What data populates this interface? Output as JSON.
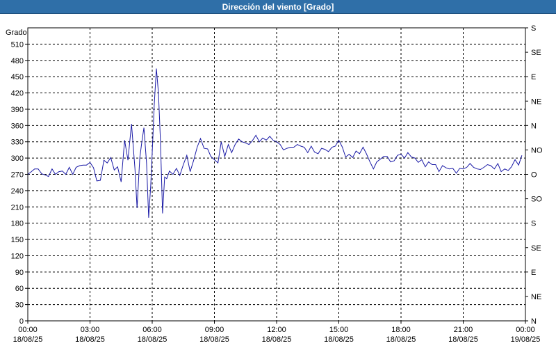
{
  "window": {
    "title": "Dirección del viento [Grado]"
  },
  "chart_data": {
    "type": "line",
    "title": "Dirección del viento [Grado]",
    "ylabel": "Grado",
    "ylim": [
      0,
      540
    ],
    "xlim": [
      0,
      24
    ],
    "y_ticks": [
      0,
      30,
      60,
      90,
      120,
      150,
      180,
      210,
      240,
      270,
      300,
      330,
      360,
      390,
      420,
      450,
      480,
      510
    ],
    "y_tick_labels": [
      "0",
      "30",
      "60",
      "90",
      "120",
      "150",
      "180",
      "210",
      "240",
      "270",
      "300",
      "330",
      "360",
      "390",
      "420",
      "450",
      "480",
      "510"
    ],
    "right_axis": {
      "ticks": [
        0,
        45,
        90,
        135,
        180,
        225,
        270,
        315,
        360,
        405,
        450,
        495,
        540
      ],
      "labels": [
        "N",
        "NE",
        "E",
        "SE",
        "S",
        "SO",
        "O",
        "NO",
        "N",
        "NE",
        "E",
        "SE",
        "S"
      ]
    },
    "x_ticks": [
      0,
      3,
      6,
      9,
      12,
      15,
      18,
      21,
      24
    ],
    "x_tick_labels": [
      [
        "00:00",
        "18/08/25"
      ],
      [
        "03:00",
        "18/08/25"
      ],
      [
        "06:00",
        "18/08/25"
      ],
      [
        "09:00",
        "18/08/25"
      ],
      [
        "12:00",
        "18/08/25"
      ],
      [
        "15:00",
        "18/08/25"
      ],
      [
        "18:00",
        "18/08/25"
      ],
      [
        "21:00",
        "18/08/25"
      ],
      [
        "00:00",
        "19/08/25"
      ]
    ],
    "grid": true,
    "series": [
      {
        "color": "#1a1aa6",
        "points": [
          [
            0.0,
            270
          ],
          [
            0.17,
            275
          ],
          [
            0.33,
            280
          ],
          [
            0.5,
            280
          ],
          [
            0.67,
            271
          ],
          [
            0.83,
            269
          ],
          [
            1.0,
            266
          ],
          [
            1.17,
            280
          ],
          [
            1.33,
            270
          ],
          [
            1.5,
            275
          ],
          [
            1.67,
            276
          ],
          [
            1.83,
            270
          ],
          [
            2.0,
            283
          ],
          [
            2.17,
            270
          ],
          [
            2.33,
            283
          ],
          [
            2.5,
            286
          ],
          [
            2.67,
            287
          ],
          [
            2.83,
            287
          ],
          [
            3.0,
            292
          ],
          [
            3.17,
            282
          ],
          [
            3.33,
            258
          ],
          [
            3.5,
            259
          ],
          [
            3.67,
            296
          ],
          [
            3.83,
            291
          ],
          [
            4.0,
            301
          ],
          [
            4.17,
            278
          ],
          [
            4.33,
            284
          ],
          [
            4.5,
            256
          ],
          [
            4.67,
            333
          ],
          [
            4.83,
            296
          ],
          [
            5.0,
            363
          ],
          [
            5.17,
            280
          ],
          [
            5.27,
            208
          ],
          [
            5.4,
            300
          ],
          [
            5.5,
            330
          ],
          [
            5.6,
            356
          ],
          [
            5.73,
            290
          ],
          [
            5.83,
            190
          ],
          [
            5.93,
            250
          ],
          [
            6.03,
            336
          ],
          [
            6.1,
            400
          ],
          [
            6.2,
            465
          ],
          [
            6.3,
            420
          ],
          [
            6.4,
            330
          ],
          [
            6.5,
            198
          ],
          [
            6.6,
            265
          ],
          [
            6.7,
            262
          ],
          [
            6.83,
            276
          ],
          [
            7.0,
            270
          ],
          [
            7.17,
            281
          ],
          [
            7.33,
            268
          ],
          [
            7.5,
            288
          ],
          [
            7.67,
            305
          ],
          [
            7.83,
            275
          ],
          [
            8.0,
            296
          ],
          [
            8.17,
            320
          ],
          [
            8.33,
            336
          ],
          [
            8.5,
            318
          ],
          [
            8.67,
            317
          ],
          [
            8.83,
            303
          ],
          [
            9.0,
            297
          ],
          [
            9.17,
            291
          ],
          [
            9.33,
            330
          ],
          [
            9.5,
            303
          ],
          [
            9.67,
            325
          ],
          [
            9.83,
            310
          ],
          [
            10.0,
            325
          ],
          [
            10.17,
            335
          ],
          [
            10.33,
            330
          ],
          [
            10.5,
            328
          ],
          [
            10.67,
            325
          ],
          [
            10.83,
            332
          ],
          [
            11.0,
            342
          ],
          [
            11.17,
            330
          ],
          [
            11.33,
            337
          ],
          [
            11.5,
            333
          ],
          [
            11.67,
            340
          ],
          [
            11.83,
            333
          ],
          [
            12.0,
            330
          ],
          [
            12.17,
            325
          ],
          [
            12.33,
            315
          ],
          [
            12.5,
            318
          ],
          [
            12.67,
            320
          ],
          [
            12.83,
            320
          ],
          [
            13.0,
            325
          ],
          [
            13.17,
            322
          ],
          [
            13.33,
            320
          ],
          [
            13.5,
            310
          ],
          [
            13.67,
            322
          ],
          [
            13.83,
            311
          ],
          [
            14.0,
            308
          ],
          [
            14.17,
            318
          ],
          [
            14.33,
            316
          ],
          [
            14.5,
            312
          ],
          [
            14.67,
            320
          ],
          [
            14.83,
            322
          ],
          [
            15.0,
            333
          ],
          [
            15.17,
            320
          ],
          [
            15.33,
            302
          ],
          [
            15.5,
            307
          ],
          [
            15.67,
            301
          ],
          [
            15.83,
            313
          ],
          [
            16.0,
            308
          ],
          [
            16.17,
            320
          ],
          [
            16.33,
            308
          ],
          [
            16.5,
            293
          ],
          [
            16.67,
            280
          ],
          [
            16.83,
            293
          ],
          [
            17.0,
            298
          ],
          [
            17.17,
            303
          ],
          [
            17.33,
            303
          ],
          [
            17.5,
            293
          ],
          [
            17.67,
            295
          ],
          [
            17.83,
            305
          ],
          [
            18.0,
            307
          ],
          [
            18.17,
            300
          ],
          [
            18.33,
            310
          ],
          [
            18.5,
            302
          ],
          [
            18.67,
            300
          ],
          [
            18.83,
            292
          ],
          [
            19.0,
            297
          ],
          [
            19.17,
            284
          ],
          [
            19.33,
            293
          ],
          [
            19.5,
            288
          ],
          [
            19.67,
            288
          ],
          [
            19.83,
            275
          ],
          [
            20.0,
            286
          ],
          [
            20.17,
            282
          ],
          [
            20.33,
            280
          ],
          [
            20.5,
            281
          ],
          [
            20.67,
            272
          ],
          [
            20.83,
            281
          ],
          [
            21.0,
            280
          ],
          [
            21.17,
            283
          ],
          [
            21.33,
            290
          ],
          [
            21.5,
            283
          ],
          [
            21.67,
            280
          ],
          [
            21.83,
            279
          ],
          [
            22.0,
            283
          ],
          [
            22.17,
            288
          ],
          [
            22.33,
            286
          ],
          [
            22.5,
            280
          ],
          [
            22.67,
            290
          ],
          [
            22.83,
            275
          ],
          [
            23.0,
            280
          ],
          [
            23.17,
            277
          ],
          [
            23.33,
            284
          ],
          [
            23.5,
            297
          ],
          [
            23.67,
            287
          ],
          [
            23.83,
            305
          ]
        ]
      }
    ]
  }
}
